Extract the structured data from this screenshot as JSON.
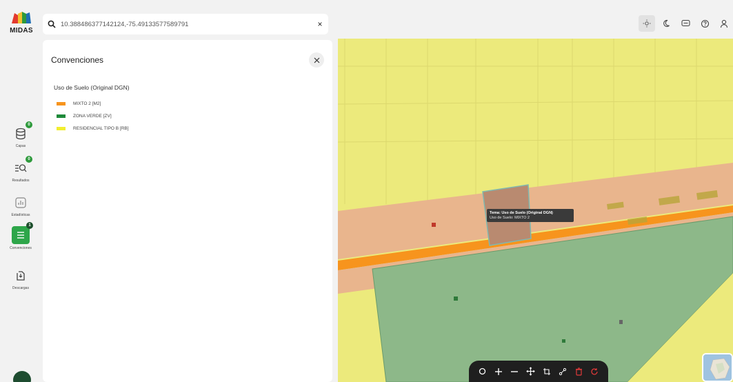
{
  "app": {
    "logo_text": "MIDAS"
  },
  "search": {
    "value": "10.388486377142124,-75.49133577589791",
    "clear_label": "×"
  },
  "rail": {
    "items": [
      {
        "label": "Capas",
        "icon": "layers-icon",
        "badge": "0"
      },
      {
        "label": "Resultados",
        "icon": "results-list-icon",
        "badge": "0"
      },
      {
        "label": "Estadísticas",
        "icon": "statistics-icon",
        "badge": ""
      },
      {
        "label": "Convenciones",
        "icon": "legend-list-icon",
        "badge": "1"
      },
      {
        "label": "Descargas",
        "icon": "download-icon",
        "badge": ""
      }
    ]
  },
  "toolbar": {
    "icons": [
      "sun-icon",
      "moon-icon",
      "message-icon",
      "help-icon",
      "user-icon"
    ]
  },
  "panel": {
    "title": "Convenciones",
    "group_title": "Uso de Suelo (Original DGN)",
    "items": [
      {
        "label": "MIXTO 2 [M2]",
        "color": "#f7941d"
      },
      {
        "label": "ZONA VERDE [ZV]",
        "color": "#1e8a3a"
      },
      {
        "label": "RESIDENCIAL TIPO B [RB]",
        "color": "#f2ee30"
      }
    ]
  },
  "map": {
    "tooltip_title": "Tema: Uso de Suelo (Original DGN)",
    "tooltip_value": "Uso de Suelo: MIXTO 2",
    "colors": {
      "residential": "#ecea7c",
      "mixed": "#e9b58d",
      "road": "#f7941d",
      "green": "#8db889"
    }
  },
  "map_tools": {
    "icons": [
      "circle-icon",
      "zoom-in-icon",
      "zoom-out-icon",
      "pan-icon",
      "select-icon",
      "measure-icon",
      "delete-icon",
      "reset-icon"
    ]
  }
}
